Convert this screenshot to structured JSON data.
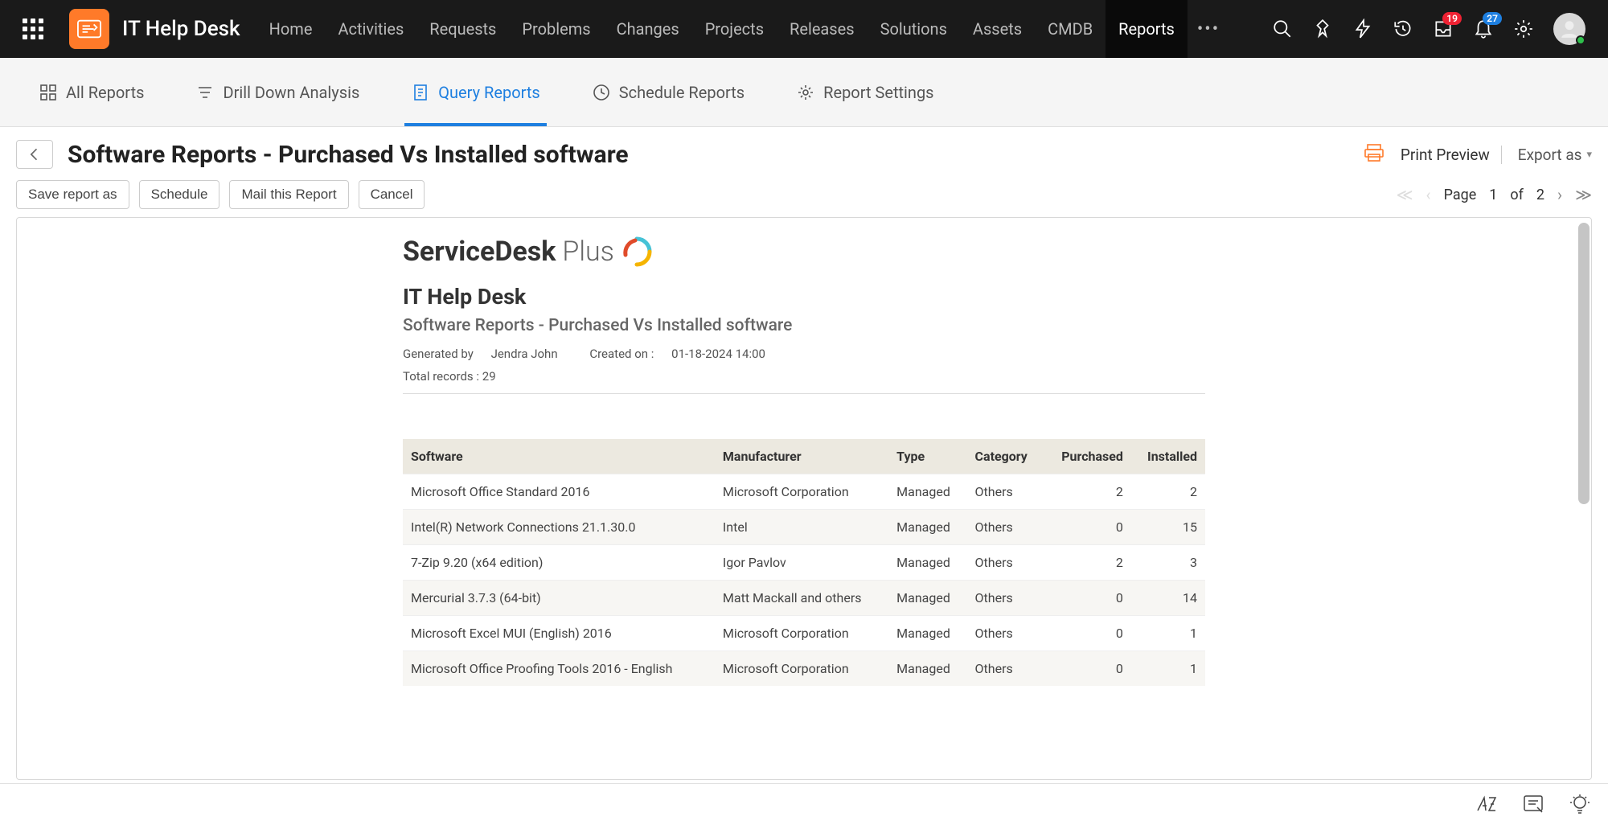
{
  "app": {
    "title": "IT Help Desk"
  },
  "topNav": {
    "items": [
      "Home",
      "Activities",
      "Requests",
      "Problems",
      "Changes",
      "Projects",
      "Releases",
      "Solutions",
      "Assets",
      "CMDB",
      "Reports"
    ],
    "activeIndex": 10
  },
  "badges": {
    "inbox": "19",
    "bell": "27"
  },
  "subTabs": {
    "items": [
      "All Reports",
      "Drill Down Analysis",
      "Query Reports",
      "Schedule Reports",
      "Report Settings"
    ],
    "activeIndex": 2
  },
  "page": {
    "title": "Software Reports - Purchased Vs Installed software",
    "printPreview": "Print Preview",
    "exportAs": "Export as"
  },
  "buttons": {
    "saveAs": "Save report as",
    "schedule": "Schedule",
    "mail": "Mail this Report",
    "cancel": "Cancel"
  },
  "pager": {
    "label": "Page",
    "current": "1",
    "of": "of",
    "total": "2"
  },
  "reportHeader": {
    "brandStrong": "ServiceDesk",
    "brandLight": "Plus",
    "title": "IT Help Desk",
    "subtitle": "Software Reports - Purchased Vs Installed software",
    "generatedByLabel": "Generated by",
    "generatedBy": "Jendra John",
    "createdOnLabel": "Created on :",
    "createdOn": "01-18-2024 14:00",
    "totalLabel": "Total records :",
    "totalValue": "29"
  },
  "table": {
    "headers": [
      "Software",
      "Manufacturer",
      "Type",
      "Category",
      "Purchased",
      "Installed"
    ],
    "rows": [
      {
        "c": [
          "Microsoft Office Standard 2016",
          "Microsoft Corporation",
          "Managed",
          "Others",
          "2",
          "2"
        ]
      },
      {
        "c": [
          "Intel(R) Network Connections 21.1.30.0",
          "Intel",
          "Managed",
          "Others",
          "0",
          "15"
        ]
      },
      {
        "c": [
          "7-Zip 9.20 (x64 edition)",
          "Igor Pavlov",
          "Managed",
          "Others",
          "2",
          "3"
        ]
      },
      {
        "c": [
          "Mercurial 3.7.3 (64-bit)",
          "Matt Mackall and others",
          "Managed",
          "Others",
          "0",
          "14"
        ]
      },
      {
        "c": [
          "Microsoft Excel MUI (English) 2016",
          "Microsoft Corporation",
          "Managed",
          "Others",
          "0",
          "1"
        ]
      },
      {
        "c": [
          "Microsoft Office Proofing Tools 2016 - English",
          "Microsoft Corporation",
          "Managed",
          "Others",
          "0",
          "1"
        ]
      }
    ]
  },
  "chart_data": {
    "type": "table",
    "title": "Software Reports - Purchased Vs Installed software",
    "columns": [
      "Software",
      "Manufacturer",
      "Type",
      "Category",
      "Purchased",
      "Installed"
    ],
    "rows": [
      [
        "Microsoft Office Standard 2016",
        "Microsoft Corporation",
        "Managed",
        "Others",
        2,
        2
      ],
      [
        "Intel(R) Network Connections 21.1.30.0",
        "Intel",
        "Managed",
        "Others",
        0,
        15
      ],
      [
        "7-Zip 9.20 (x64 edition)",
        "Igor Pavlov",
        "Managed",
        "Others",
        2,
        3
      ],
      [
        "Mercurial 3.7.3 (64-bit)",
        "Matt Mackall and others",
        "Managed",
        "Others",
        0,
        14
      ],
      [
        "Microsoft Excel MUI (English) 2016",
        "Microsoft Corporation",
        "Managed",
        "Others",
        0,
        1
      ],
      [
        "Microsoft Office Proofing Tools 2016 - English",
        "Microsoft Corporation",
        "Managed",
        "Others",
        0,
        1
      ]
    ],
    "total_records": 29
  }
}
